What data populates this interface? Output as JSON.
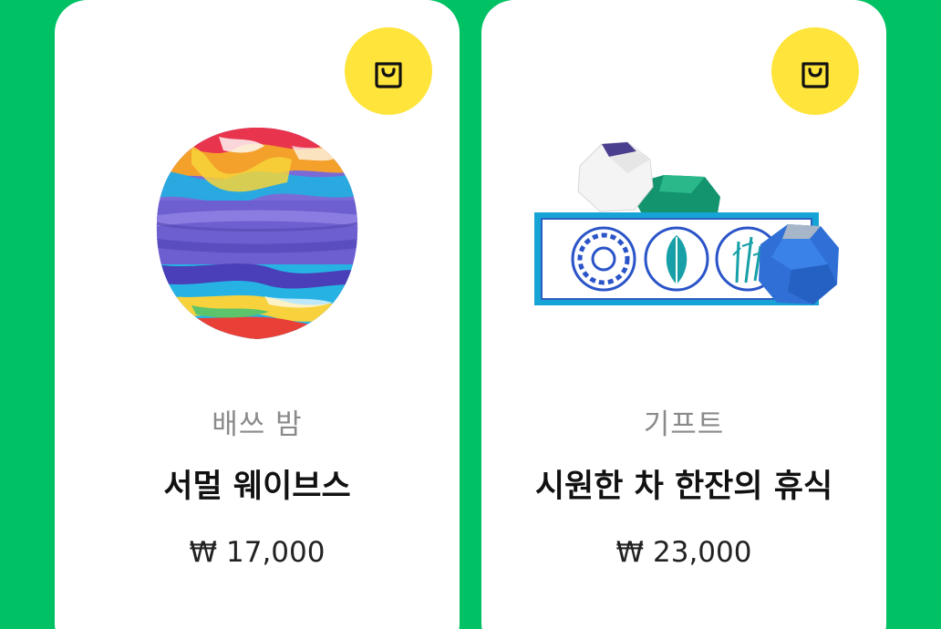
{
  "colors": {
    "background": "#00c164",
    "card": "#ffffff",
    "cart_button": "#ffe43b"
  },
  "products": [
    {
      "category": "배쓰 밤",
      "name": "서멀 웨이브스",
      "price": "₩ 17,000",
      "cart_icon": "shopping-bag-icon",
      "image": "rainbow-bath-bomb"
    },
    {
      "category": "기프트",
      "name": "시원한 차 한잔의 휴식",
      "price": "₩ 23,000",
      "cart_icon": "shopping-bag-icon",
      "image": "gift-set-box"
    }
  ]
}
